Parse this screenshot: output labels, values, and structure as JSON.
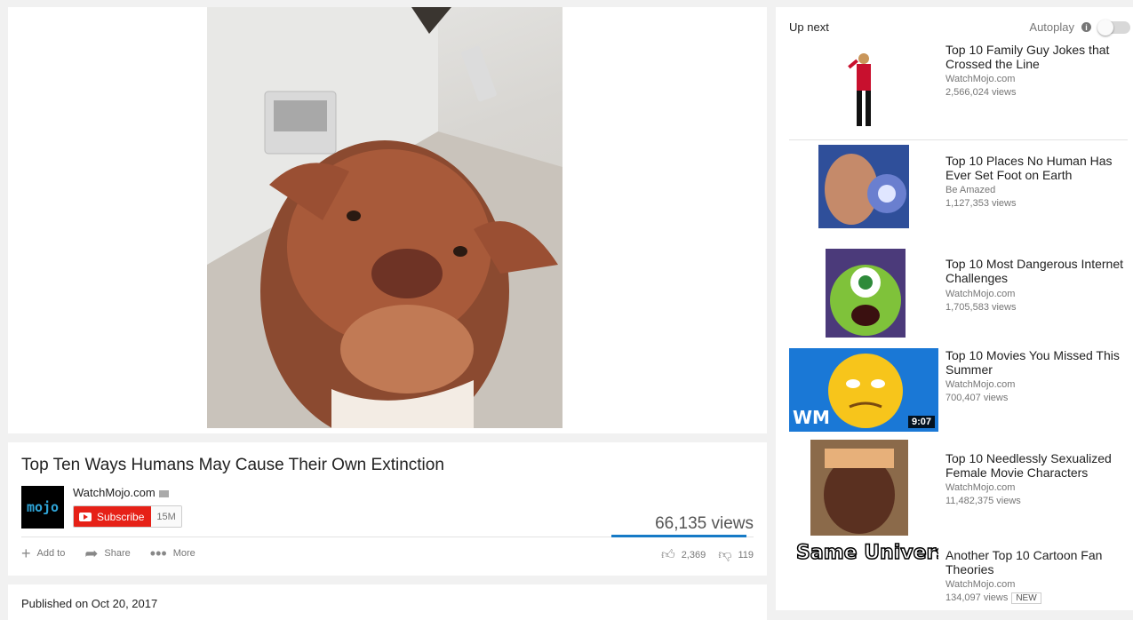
{
  "video": {
    "title": "Top Ten Ways Humans May Cause Their Own Extinction",
    "views": "66,135 views",
    "likes": "2,369",
    "dislikes": "119",
    "like_ratio": 0.95,
    "published": "Published on Oct 20, 2017"
  },
  "channel": {
    "name": "WatchMojo.com",
    "avatar_text": "mojo",
    "subscribe_label": "Subscribe",
    "subscriber_count": "15M"
  },
  "actions": {
    "add_to": "Add to",
    "share": "Share",
    "more": "More"
  },
  "sidebar": {
    "up_next": "Up next",
    "autoplay": "Autoplay",
    "items": [
      {
        "title": "Top 10 Family Guy Jokes that Crossed the Line",
        "channel": "WatchMojo.com",
        "views": "2,566,024 views"
      },
      {
        "title": "Top 10 Places No Human Has Ever Set Foot on Earth",
        "channel": "Be Amazed",
        "views": "1,127,353 views"
      },
      {
        "title": "Top 10 Most Dangerous Internet Challenges",
        "channel": "WatchMojo.com",
        "views": "1,705,583 views"
      },
      {
        "title": "Top 10 Movies You Missed This Summer",
        "channel": "WatchMojo.com",
        "views": "700,407 views",
        "duration": "9:07",
        "thumb_text": "WM"
      },
      {
        "title": "Top 10 Needlessly Sexualized Female Movie Characters",
        "channel": "WatchMojo.com",
        "views": "11,482,375 views"
      },
      {
        "title": "Another Top 10 Cartoon Fan Theories",
        "channel": "WatchMojo.com",
        "views": "134,097 views",
        "badge": "NEW",
        "thumb_text": "Same Universe"
      }
    ]
  },
  "colors": {
    "subscribe_red": "#e62117",
    "like_bar_blue": "#167ac6"
  }
}
